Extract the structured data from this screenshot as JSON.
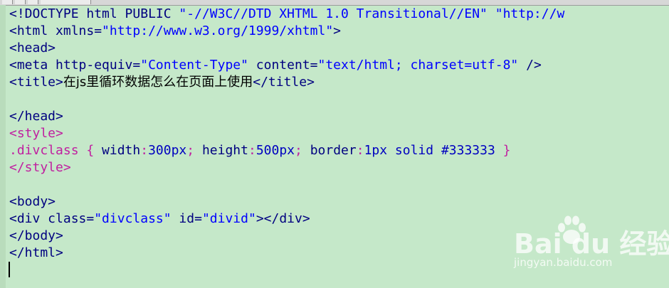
{
  "colors": {
    "background": "#c5e8c9",
    "tag": "#000080",
    "attribute_value": "#0000ff",
    "style_tag": "#c020a0",
    "style_rule": "#c020a0",
    "style_property": "#000080",
    "style_value": "#0000c0",
    "plain_text": "#000000"
  },
  "editor": {
    "lines": [
      [
        {
          "t": "<!DOCTYPE html PUBLIC ",
          "c": "tag"
        },
        {
          "t": "\"-//W3C//DTD XHTML 1.0 Transitional//EN\"",
          "c": "attribute_value"
        },
        {
          "t": " ",
          "c": "tag"
        },
        {
          "t": "\"http://w",
          "c": "attribute_value"
        }
      ],
      [
        {
          "t": "<html xmlns=",
          "c": "tag"
        },
        {
          "t": "\"http://www.w3.org/1999/xhtml\"",
          "c": "attribute_value"
        },
        {
          "t": ">",
          "c": "tag"
        }
      ],
      [
        {
          "t": "<head>",
          "c": "tag"
        }
      ],
      [
        {
          "t": "<meta http-equiv=",
          "c": "tag"
        },
        {
          "t": "\"Content-Type\"",
          "c": "attribute_value"
        },
        {
          "t": " content=",
          "c": "tag"
        },
        {
          "t": "\"text/html; charset=utf-8\"",
          "c": "attribute_value"
        },
        {
          "t": " />",
          "c": "tag"
        }
      ],
      [
        {
          "t": "<title>",
          "c": "tag"
        },
        {
          "t": "在js里循环数据怎么在页面上使用",
          "c": "plain_text",
          "cjk": true
        },
        {
          "t": "</title>",
          "c": "tag"
        }
      ],
      [],
      [
        {
          "t": "</head>",
          "c": "tag"
        }
      ],
      [
        {
          "t": "<style>",
          "c": "style_tag"
        }
      ],
      [
        {
          "t": ".divclass { ",
          "c": "style_rule"
        },
        {
          "t": "width",
          "c": "style_property"
        },
        {
          "t": ":",
          "c": "style_rule"
        },
        {
          "t": "300px",
          "c": "style_value"
        },
        {
          "t": "; ",
          "c": "style_rule"
        },
        {
          "t": "height",
          "c": "style_property"
        },
        {
          "t": ":",
          "c": "style_rule"
        },
        {
          "t": "500px",
          "c": "style_value"
        },
        {
          "t": "; ",
          "c": "style_rule"
        },
        {
          "t": "border",
          "c": "style_property"
        },
        {
          "t": ":",
          "c": "style_rule"
        },
        {
          "t": "1px solid #333333",
          "c": "style_value"
        },
        {
          "t": " }",
          "c": "style_rule"
        }
      ],
      [
        {
          "t": "</style>",
          "c": "style_tag"
        }
      ],
      [],
      [
        {
          "t": "<body>",
          "c": "tag"
        }
      ],
      [
        {
          "t": "<div class=",
          "c": "tag"
        },
        {
          "t": "\"divclass\"",
          "c": "attribute_value"
        },
        {
          "t": " id=",
          "c": "tag"
        },
        {
          "t": "\"divid\"",
          "c": "attribute_value"
        },
        {
          "t": "></div>",
          "c": "tag"
        }
      ],
      [
        {
          "t": "</body>",
          "c": "tag"
        }
      ],
      [
        {
          "t": "</html>",
          "c": "tag"
        }
      ],
      []
    ]
  },
  "watermark": {
    "logo_text": "Bai du 经验",
    "url": "jingyan.baidu.com"
  }
}
